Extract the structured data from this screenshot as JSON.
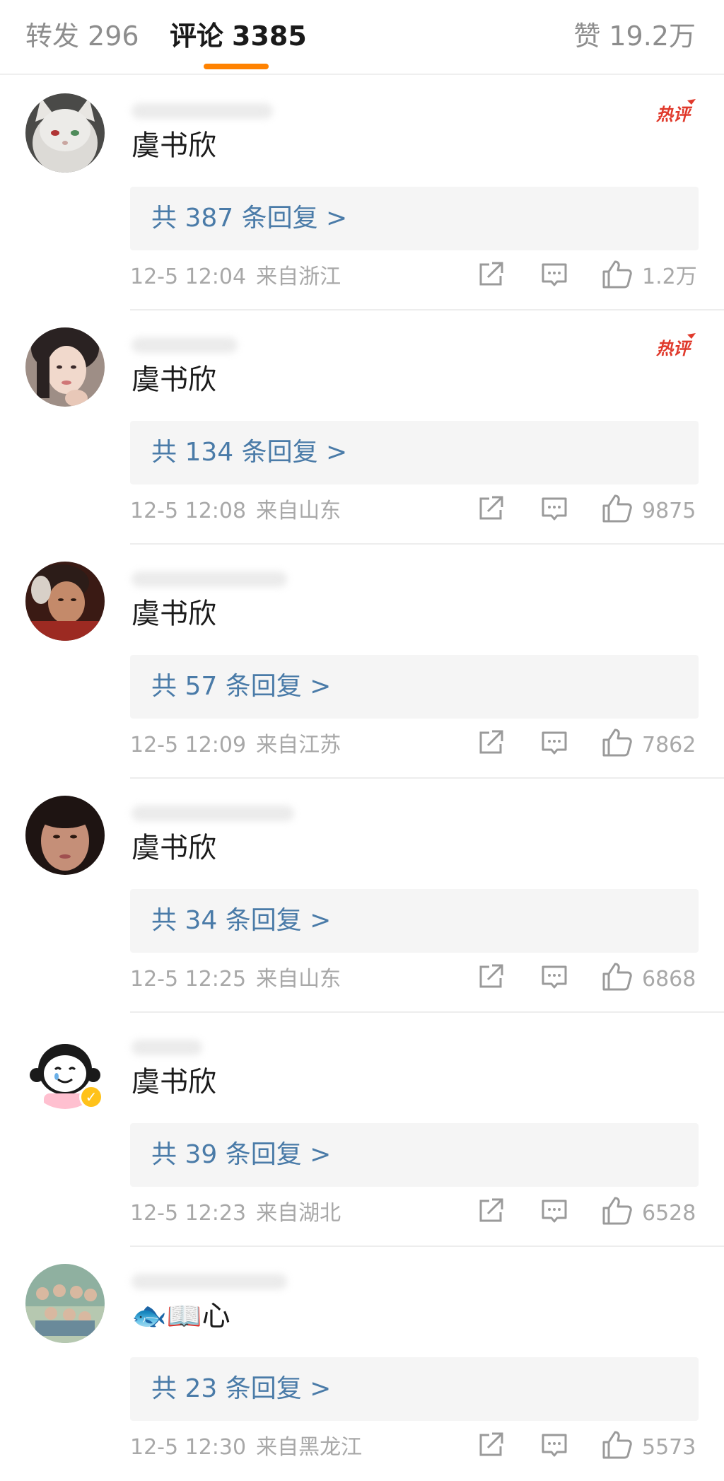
{
  "tabs": {
    "repost": {
      "label": "转发",
      "count": "296"
    },
    "comments": {
      "label": "评论",
      "count": "3385"
    },
    "likes": {
      "label": "赞",
      "count": "19.2万"
    }
  },
  "colors": {
    "accent": "#ff8200",
    "link": "#4a7ba8",
    "meta": "#a8a8a8",
    "hot": "#e0392b"
  },
  "icons": {
    "share": "share-icon",
    "reply": "comment-icon",
    "like": "thumbs-up-icon",
    "hot": "hot-comment-badge"
  },
  "hot_label": "热评",
  "comments": [
    {
      "text": "虞书欣",
      "replies": "共 387 条回复 >",
      "time": "12-5 12:04",
      "location": "来自浙江",
      "likes": "1.2万",
      "hot": true
    },
    {
      "text": "虞书欣",
      "replies": "共 134 条回复 >",
      "time": "12-5 12:08",
      "location": "来自山东",
      "likes": "9875",
      "hot": true
    },
    {
      "text": "虞书欣",
      "replies": "共 57 条回复 >",
      "time": "12-5 12:09",
      "location": "来自江苏",
      "likes": "7862",
      "hot": false
    },
    {
      "text": "虞书欣",
      "replies": "共 34 条回复 >",
      "time": "12-5 12:25",
      "location": "来自山东",
      "likes": "6868",
      "hot": false
    },
    {
      "text": "虞书欣",
      "replies": "共 39 条回复 >",
      "time": "12-5 12:23",
      "location": "来自湖北",
      "likes": "6528",
      "hot": false,
      "verified": true
    },
    {
      "text": "🐟📖心",
      "replies": "共 23 条回复 >",
      "time": "12-5 12:30",
      "location": "来自黑龙江",
      "likes": "5573",
      "hot": false
    }
  ]
}
